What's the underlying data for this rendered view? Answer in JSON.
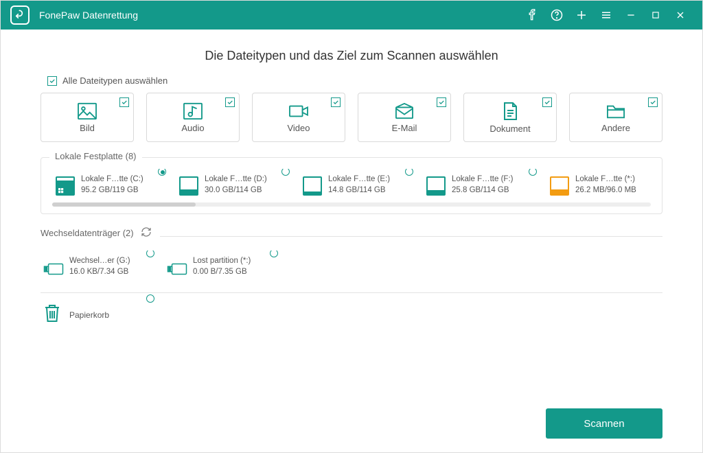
{
  "app": {
    "title": "FonePaw Datenrettung"
  },
  "headline": "Die Dateitypen und das Ziel zum Scannen auswählen",
  "select_all_label": "Alle Dateitypen auswählen",
  "types": [
    {
      "label": "Bild"
    },
    {
      "label": "Audio"
    },
    {
      "label": "Video"
    },
    {
      "label": "E-Mail"
    },
    {
      "label": "Dokument"
    },
    {
      "label": "Andere"
    }
  ],
  "local_section": {
    "title": "Lokale Festplatte (8)",
    "drives": [
      {
        "name": "Lokale F…tte (C:)",
        "size": "95.2 GB/119 GB"
      },
      {
        "name": "Lokale F…tte (D:)",
        "size": "30.0 GB/114 GB"
      },
      {
        "name": "Lokale F…tte (E:)",
        "size": "14.8 GB/114 GB"
      },
      {
        "name": "Lokale F…tte (F:)",
        "size": "25.8 GB/114 GB"
      },
      {
        "name": "Lokale F…tte (*:)",
        "size": "26.2 MB/96.0 MB"
      }
    ]
  },
  "removable_section": {
    "title": "Wechseldatenträger (2)",
    "drives": [
      {
        "name": "Wechsel…er (G:)",
        "size": "16.0 KB/7.34 GB"
      },
      {
        "name": "Lost partition (*:)",
        "size": "0.00  B/7.35 GB"
      }
    ]
  },
  "recycle_label": "Papierkorb",
  "scan_button": "Scannen"
}
